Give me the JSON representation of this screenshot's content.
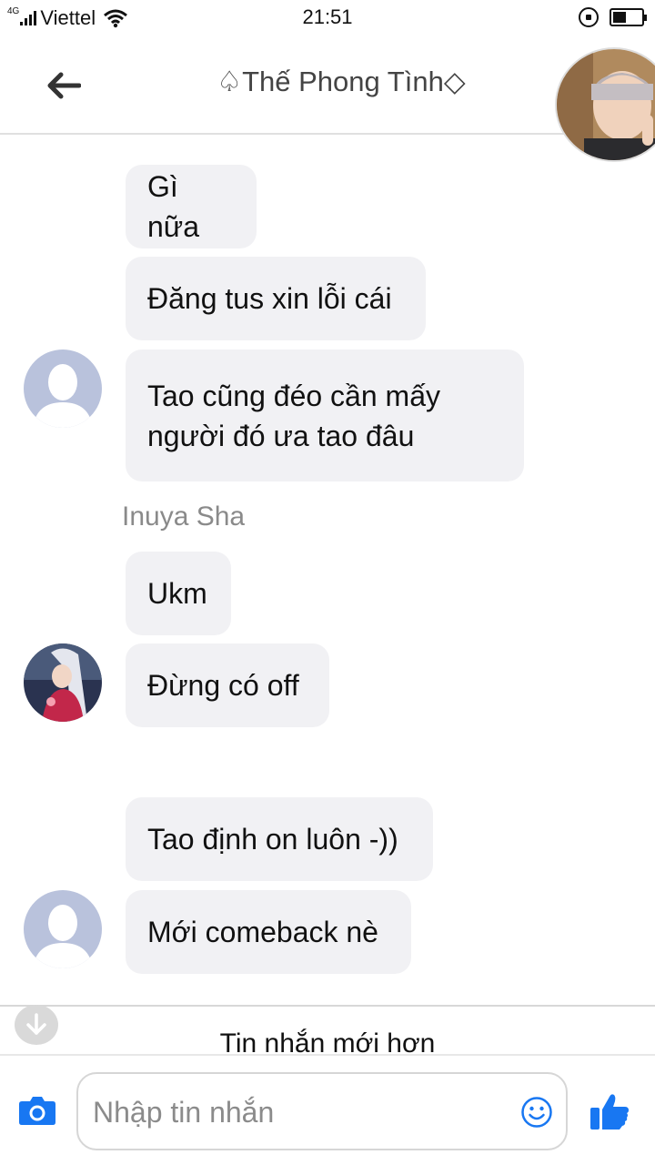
{
  "status_bar": {
    "network_type": "4G",
    "carrier": "Viettel",
    "time": "21:51",
    "battery_level": 0.45
  },
  "header": {
    "title": "♤Thế Phong Tình◇"
  },
  "messages": [
    {
      "text": "Gì nữa"
    },
    {
      "text": "Đăng tus xin lỗi cái"
    },
    {
      "line1": "Tao cũng đéo cần mấy",
      "line2": "người đó ưa tao đâu"
    },
    {
      "text": "Ukm"
    },
    {
      "text": "Đừng có off"
    },
    {
      "text": "Tao định on luôn -))"
    },
    {
      "text": "Mới comeback nè"
    }
  ],
  "sender_name": "Inuya Sha",
  "newer_messages_label": "Tin nhắn mới hơn",
  "composer": {
    "placeholder": "Nhập tin nhắn"
  },
  "colors": {
    "accent": "#1877f2",
    "bubble": "#f1f1f4",
    "avatar_placeholder": "#b9c2dc"
  },
  "icons": [
    "back-arrow-icon",
    "camera-icon",
    "emoji-icon",
    "thumbs-up-icon",
    "arrow-down-icon",
    "wifi-icon",
    "signal-icon",
    "battery-icon",
    "rotation-lock-icon"
  ]
}
